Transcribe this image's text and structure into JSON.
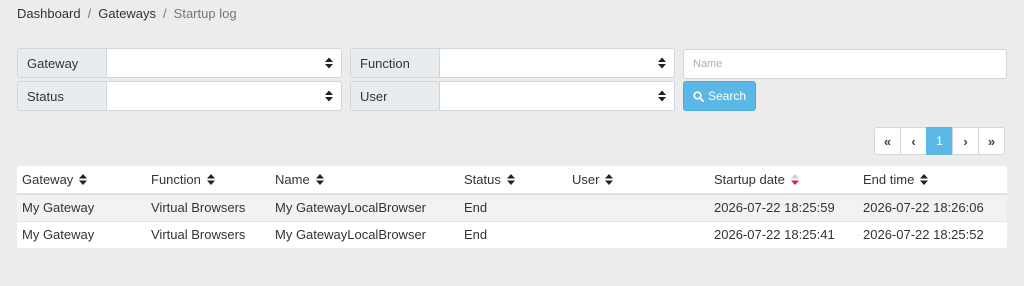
{
  "breadcrumb": {
    "items": [
      "Dashboard",
      "Gateways"
    ],
    "current": "Startup log"
  },
  "filters": {
    "gateway_label": "Gateway",
    "function_label": "Function",
    "status_label": "Status",
    "user_label": "User",
    "gateway_value": "",
    "function_value": "",
    "status_value": "",
    "user_value": "",
    "name_placeholder": "Name",
    "name_value": "",
    "search_label": "Search"
  },
  "pagination": {
    "first": "«",
    "prev": "‹",
    "current_page": "1",
    "next": "›",
    "last": "»"
  },
  "table": {
    "columns": [
      "Gateway",
      "Function",
      "Name",
      "Status",
      "User",
      "Startup date",
      "End time"
    ],
    "sorted_column": "Startup date",
    "rows": [
      [
        "My Gateway",
        "Virtual Browsers",
        "My GatewayLocalBrowser",
        "End",
        "",
        "2026-07-22 18:25:59",
        "2026-07-22 18:26:06"
      ],
      [
        "My Gateway",
        "Virtual Browsers",
        "My GatewayLocalBrowser",
        "End",
        "",
        "2026-07-22 18:25:41",
        "2026-07-22 18:25:52"
      ]
    ]
  },
  "colors": {
    "accent": "#5bb7e6",
    "sort_active": "#e0195a"
  }
}
